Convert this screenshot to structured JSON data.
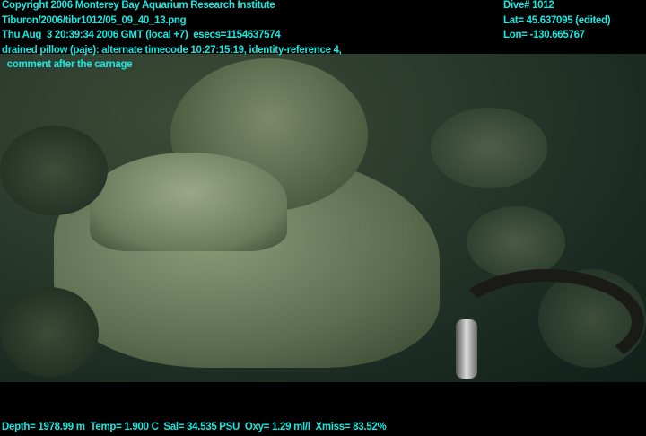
{
  "overlay_top_left": {
    "line1": "Copyright 2006 Monterey Bay Aquarium Research Institute",
    "line2": "Tiburon/2006/tibr1012/05_09_40_13.png",
    "line3": "Thu Aug  3 20:39:34 2006 GMT (local +7)  esecs=1154637574",
    "line4": "drained pillow (pajе): alternate timecode 10:27:15:19, identity-reference 4,",
    "line5": "  comment after the carnage"
  },
  "overlay_top_right": {
    "dive": "Dive# 1012",
    "lat": "Lat= 45.637095 (edited)",
    "lon": "Lon= -130.665767"
  },
  "overlay_bottom": {
    "sensors": "Depth= 1978.99 m  Temp= 1.900 C  Sal= 34.535 PSU  Oxy= 1.29 ml/l  Xmiss= 83.52%"
  },
  "colors": {
    "overlay_text": "#18e8e0"
  }
}
